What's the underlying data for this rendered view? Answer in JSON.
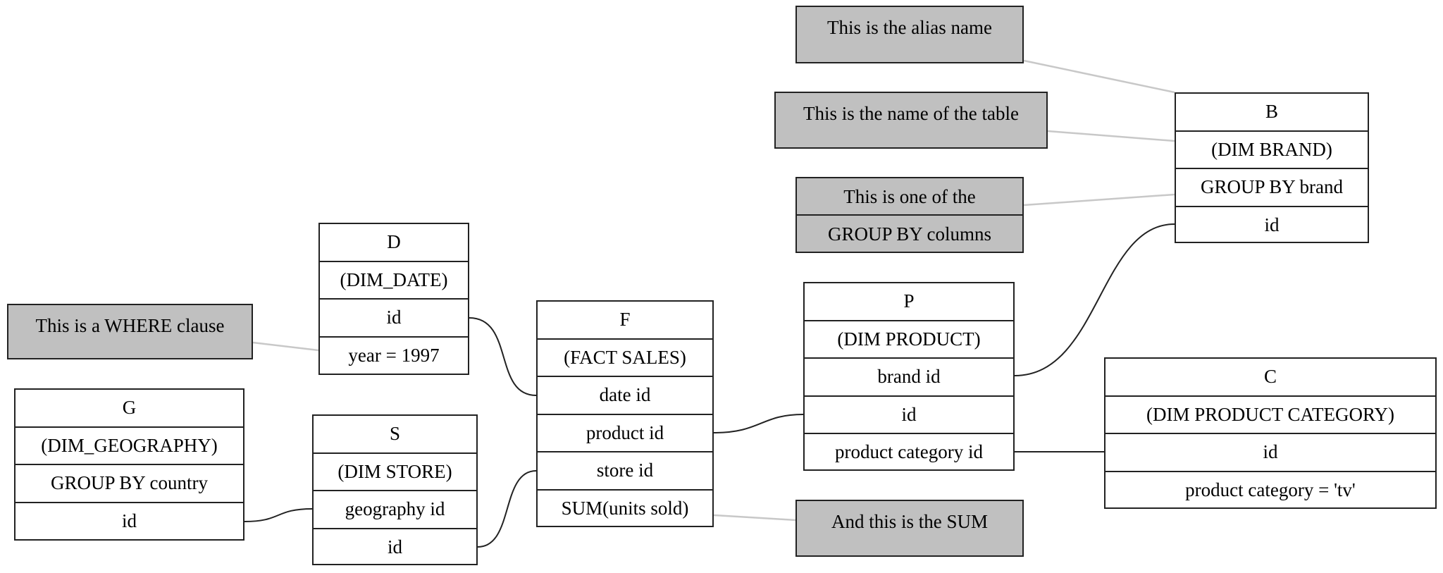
{
  "diagram": {
    "type": "star-schema query diagram",
    "tables": {
      "D": {
        "alias": "D",
        "name": "(DIM_DATE)",
        "fields": [
          "id",
          "year = 1997"
        ]
      },
      "G": {
        "alias": "G",
        "name": "(DIM_GEOGRAPHY)",
        "fields": [
          "GROUP BY country",
          "id"
        ]
      },
      "S": {
        "alias": "S",
        "name": "(DIM STORE)",
        "fields": [
          "geography id",
          "id"
        ]
      },
      "F": {
        "alias": "F",
        "name": "(FACT SALES)",
        "fields": [
          "date id",
          "product id",
          "store id",
          "SUM(units sold)"
        ]
      },
      "P": {
        "alias": "P",
        "name": "(DIM PRODUCT)",
        "fields": [
          "brand id",
          "id",
          "product category id"
        ]
      },
      "B": {
        "alias": "B",
        "name": "(DIM BRAND)",
        "fields": [
          "GROUP BY brand",
          "id"
        ]
      },
      "C": {
        "alias": "C",
        "name": "(DIM PRODUCT CATEGORY)",
        "fields": [
          "id",
          "product category = 'tv'"
        ]
      }
    },
    "notes": {
      "where": [
        "This is a WHERE clause"
      ],
      "alias": [
        "This is the alias name"
      ],
      "table_name": [
        "This is the name of the table"
      ],
      "group_by": [
        "This is one of the",
        "GROUP BY columns"
      ],
      "sum": [
        "And this is the SUM"
      ]
    },
    "joins": [
      {
        "from": "D.id",
        "to": "F.date id"
      },
      {
        "from": "G.id",
        "to": "S.geography id"
      },
      {
        "from": "S.id",
        "to": "F.store id"
      },
      {
        "from": "F.product id",
        "to": "P.id"
      },
      {
        "from": "P.brand id",
        "to": "B.id"
      },
      {
        "from": "P.product category id",
        "to": "C.id"
      }
    ],
    "annotations": [
      {
        "note": "where",
        "target": "D.year = 1997"
      },
      {
        "note": "alias",
        "target": "B.alias"
      },
      {
        "note": "table_name",
        "target": "B.name"
      },
      {
        "note": "group_by",
        "target": "B.GROUP BY brand"
      },
      {
        "note": "sum",
        "target": "F.SUM(units sold)"
      }
    ],
    "colors": {
      "note_fill": "#c0c0c0",
      "border": "#222222",
      "join_edge": "#222222",
      "annotation_edge": "#c8c8c8"
    }
  }
}
